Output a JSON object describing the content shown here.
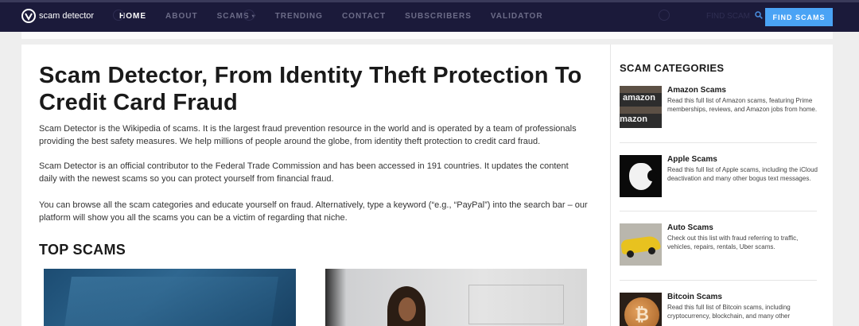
{
  "header": {
    "logo_text": "scam detector",
    "nav": [
      {
        "label": "HOME",
        "active": true
      },
      {
        "label": "ABOUT",
        "active": false
      },
      {
        "label": "SCAMS",
        "active": false,
        "has_dropdown": true
      },
      {
        "label": "TRENDING",
        "active": false
      },
      {
        "label": "CONTACT",
        "active": false
      },
      {
        "label": "SUBSCRIBERS",
        "active": false
      },
      {
        "label": "VALIDATOR",
        "active": false
      }
    ],
    "search_label": "FIND SCAM",
    "cta_label": "FIND SCAMS"
  },
  "main": {
    "title": "Scam Detector, From Identity Theft Protection To Credit Card Fraud",
    "paragraph_1": "Scam Detector is the Wikipedia of scams. It is the largest fraud prevention resource in the world and is operated by a team of professionals providing the best safety measures. We help millions of people around the globe, from identity theft protection to credit card fraud.",
    "paragraph_2": "Scam Detector is an official contributor to the Federal Trade Commission and has been accessed in 191 countries. It updates the content daily with the newest scams so you can protect yourself from financial fraud.",
    "paragraph_3": "You can browse all the scam categories and educate yourself on fraud. Alternatively, type a keyword (“e.g., “PayPal”) into the search bar – our platform will show you all the scams you can be a victim of regarding that niche.",
    "section_title": "TOP SCAMS"
  },
  "sidebar": {
    "title": "SCAM CATEGORIES",
    "items": [
      {
        "name": "Amazon Scams",
        "description": "Read this full list of Amazon scams, featuring Prime memberships, reviews, and Amazon jobs from home.",
        "thumb_text": "amazon"
      },
      {
        "name": "Apple Scams",
        "description": "Read this full list of Apple scams, including the iCloud deactivation and many other bogus text messages."
      },
      {
        "name": "Auto Scams",
        "description": "Check out this list with fraud referring to traffic, vehicles, repairs, rentals, Uber scams."
      },
      {
        "name": "Bitcoin Scams",
        "description": "Read this full list of Bitcoin scams, including cryptocurrency, blockchain, and many other"
      }
    ]
  },
  "colors": {
    "topbar": "#1b1a3a",
    "accent": "#4aa3f5",
    "nav_inactive": "#6c6c88"
  }
}
